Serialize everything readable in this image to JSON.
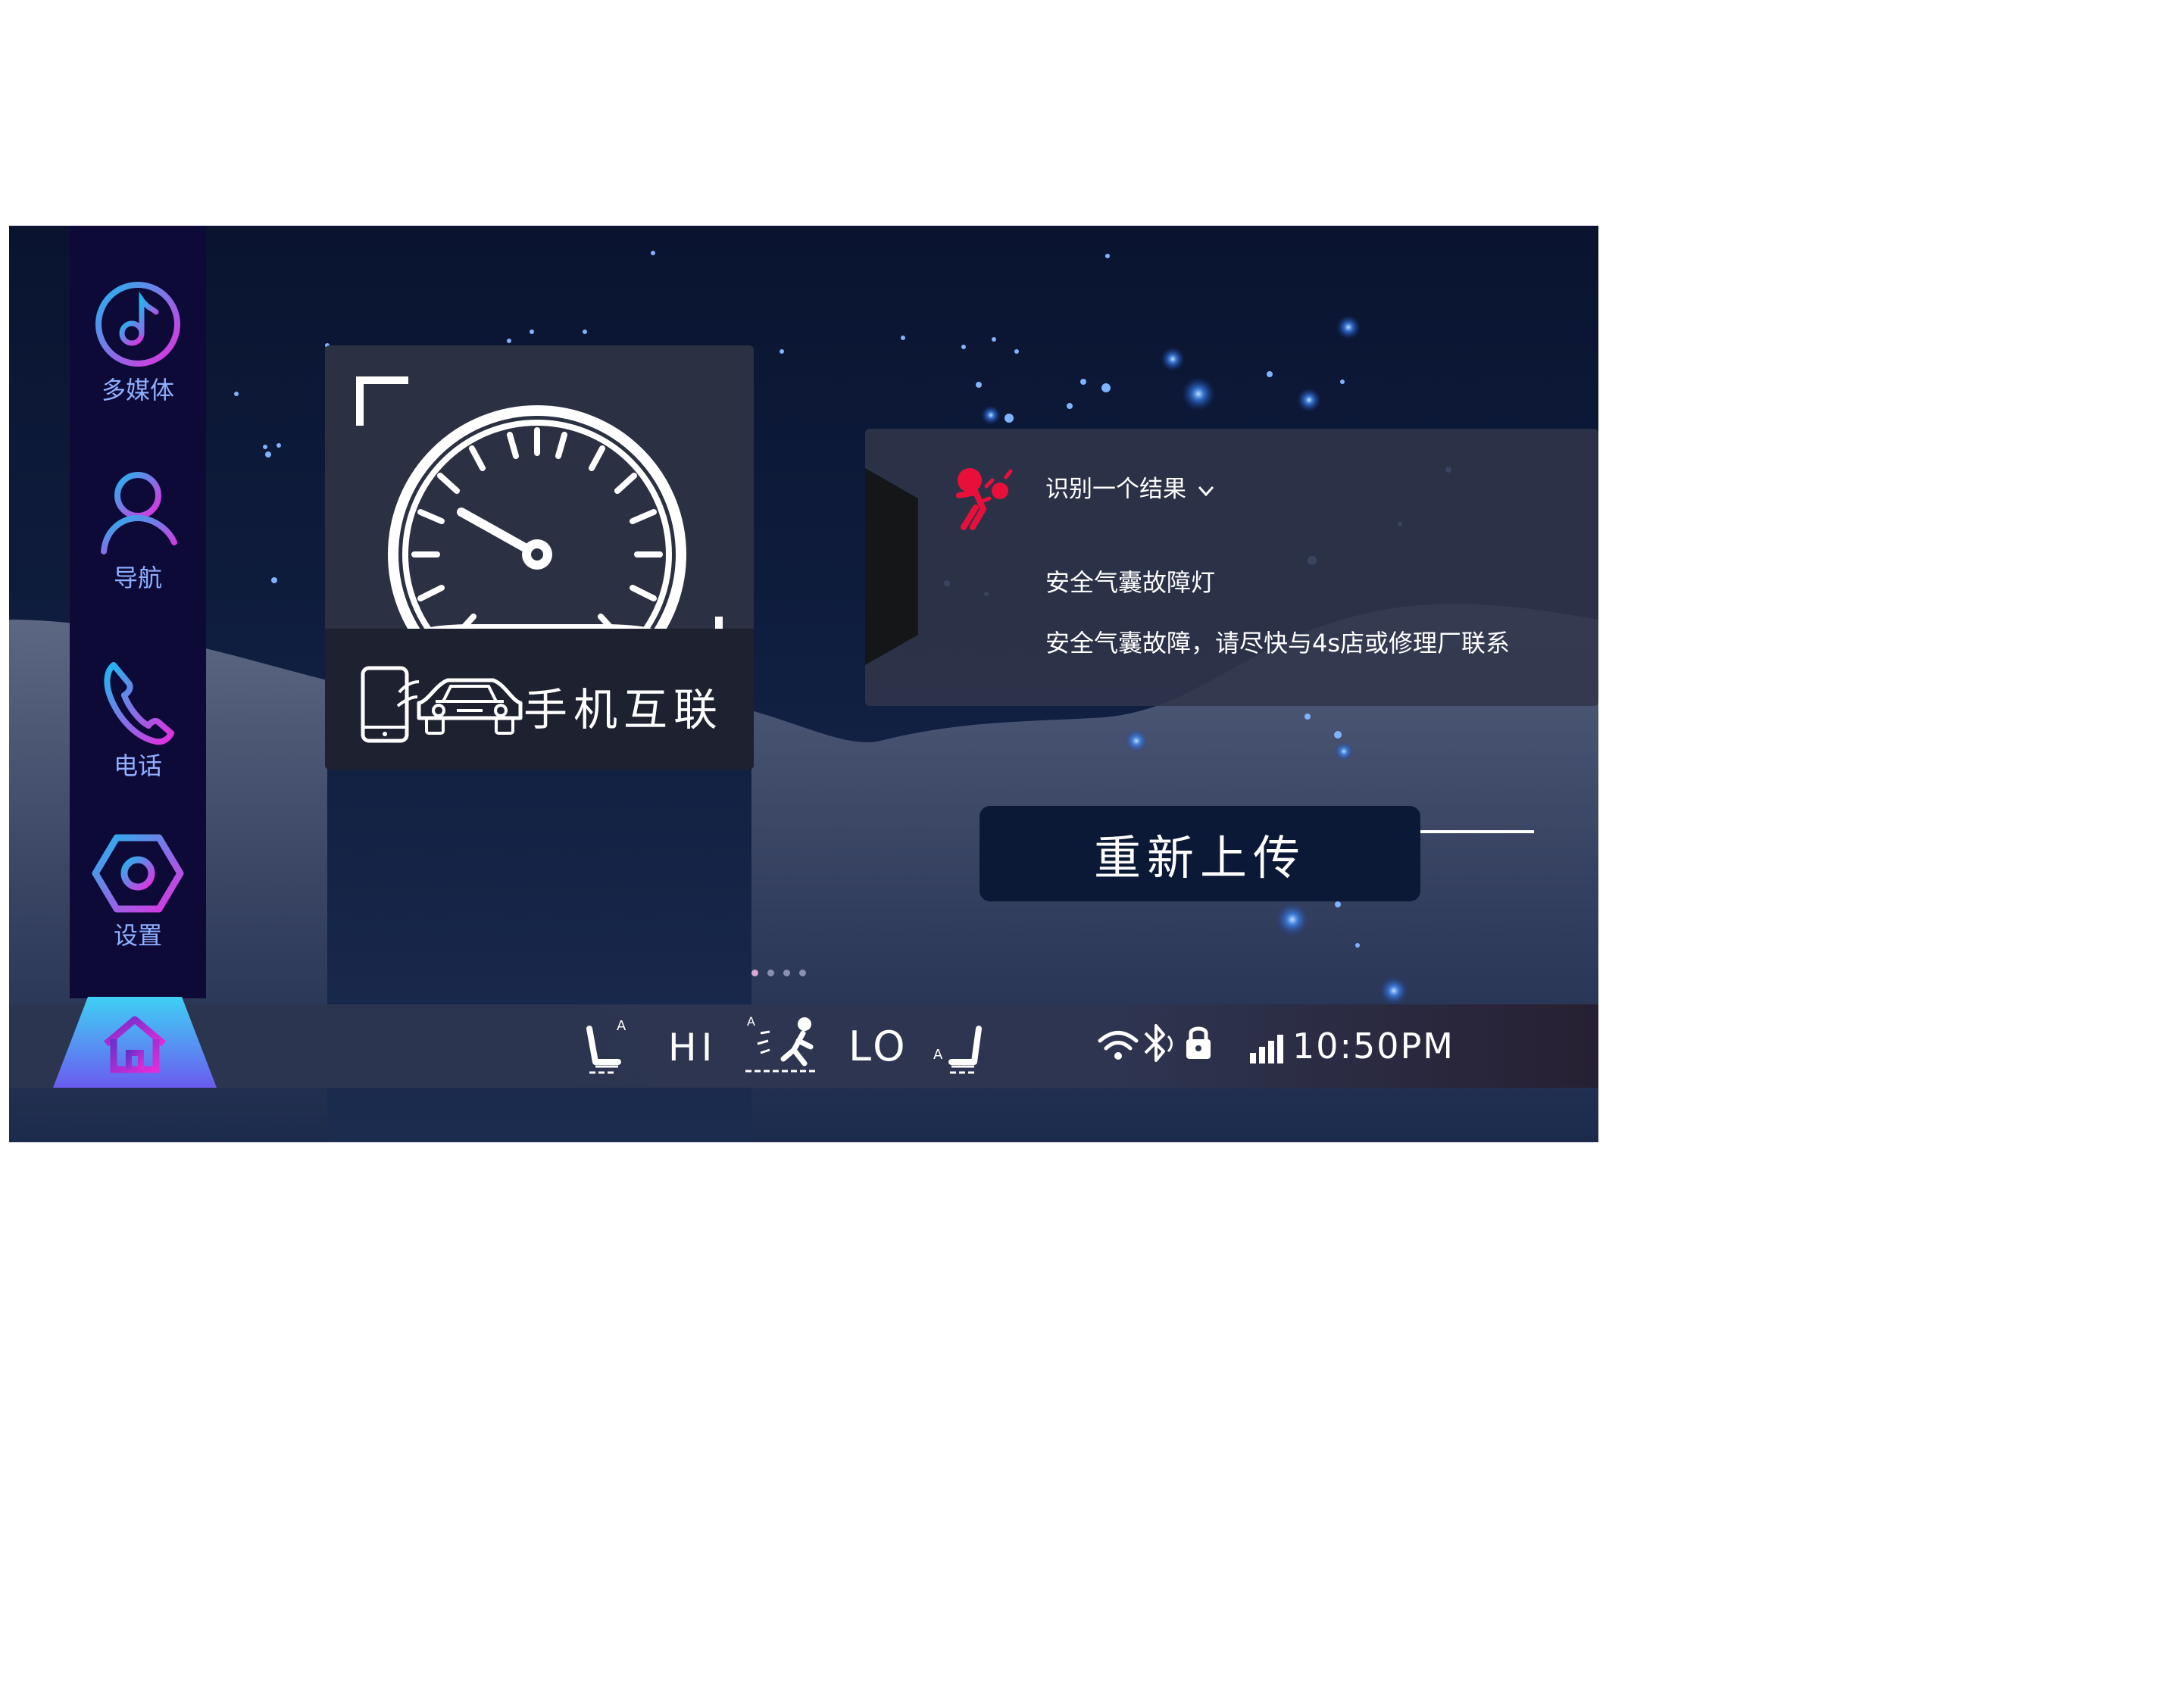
{
  "sidebar": {
    "items": [
      {
        "label": "多媒体",
        "icon": "music-note-icon"
      },
      {
        "label": "导航",
        "icon": "person-icon"
      },
      {
        "label": "电话",
        "icon": "phone-icon"
      },
      {
        "label": "设置",
        "icon": "hexagon-settings-icon"
      }
    ]
  },
  "speed_card": {
    "icon": "speedometer-icon",
    "link_icon": "phone-car-link-icon",
    "label": "手机互联"
  },
  "result_panel": {
    "icon": "airbag-warning-icon",
    "icon_color": "#e8103a",
    "title": "识别一个结果",
    "line1": "安全气囊故障灯",
    "line2": "安全气囊故障，请尽快与4s店或修理厂联系"
  },
  "reupload_label": "重新上传",
  "pager": {
    "pages": 4,
    "current": 1
  },
  "status_bar": {
    "home_icon": "home-icon",
    "seat_heat_left_icon": "seat-auto-left-icon",
    "fan_level_hi": "HI",
    "airflow_icon": "airflow-person-icon",
    "fan_level_lo": "LO",
    "seat_heat_right_icon": "seat-auto-right-icon",
    "wifi_icon": "wifi-icon",
    "bluetooth_icon": "bluetooth-icon",
    "lock_icon": "lock-icon",
    "signal_icon": "signal-bars-icon",
    "time": "10:50PM"
  },
  "colors": {
    "accent_gradient_start": "#20b8ee",
    "accent_gradient_end": "#e82de0",
    "background": "#0f1d3e"
  }
}
